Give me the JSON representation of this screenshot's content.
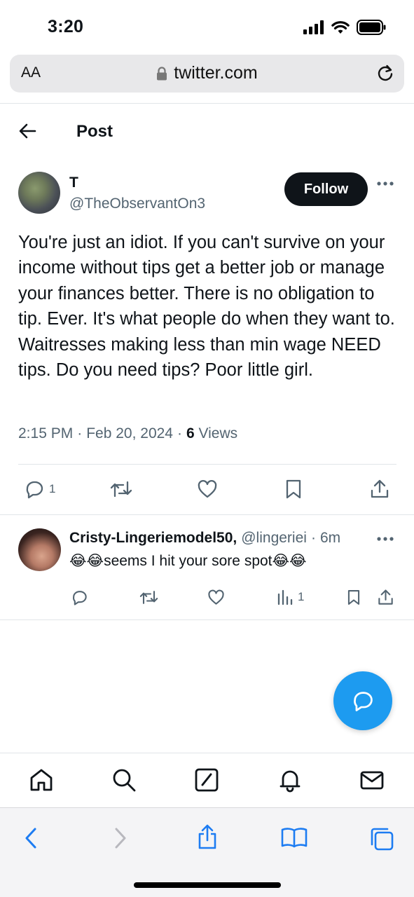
{
  "status": {
    "time": "3:20"
  },
  "browser": {
    "text_size": "AA",
    "url": "twitter.com"
  },
  "header": {
    "title": "Post"
  },
  "post": {
    "author_name": "T",
    "author_handle": "@TheObservantOn3",
    "follow_label": "Follow",
    "text": "You're just an idiot. If you can't survive on your income without tips get a better job or manage your finances better. There is no obligation to tip. Ever. It's what people do when they want to. Waitresses making less than min wage NEED tips. Do you need tips? Poor little girl.",
    "time": "2:15 PM",
    "date": "Feb 20, 2024",
    "views_count": "6",
    "views_label": "Views",
    "reply_count": "1"
  },
  "reply": {
    "author_name": "Cristy-Lingeriemodel50,",
    "author_handle": "@lingeriei",
    "age": "6m",
    "text": "😂😂seems I hit your sore spot😂😂",
    "views_count": "1"
  },
  "colors": {
    "accent": "#1d9bf0",
    "text": "#0f1419",
    "muted": "#536471"
  }
}
